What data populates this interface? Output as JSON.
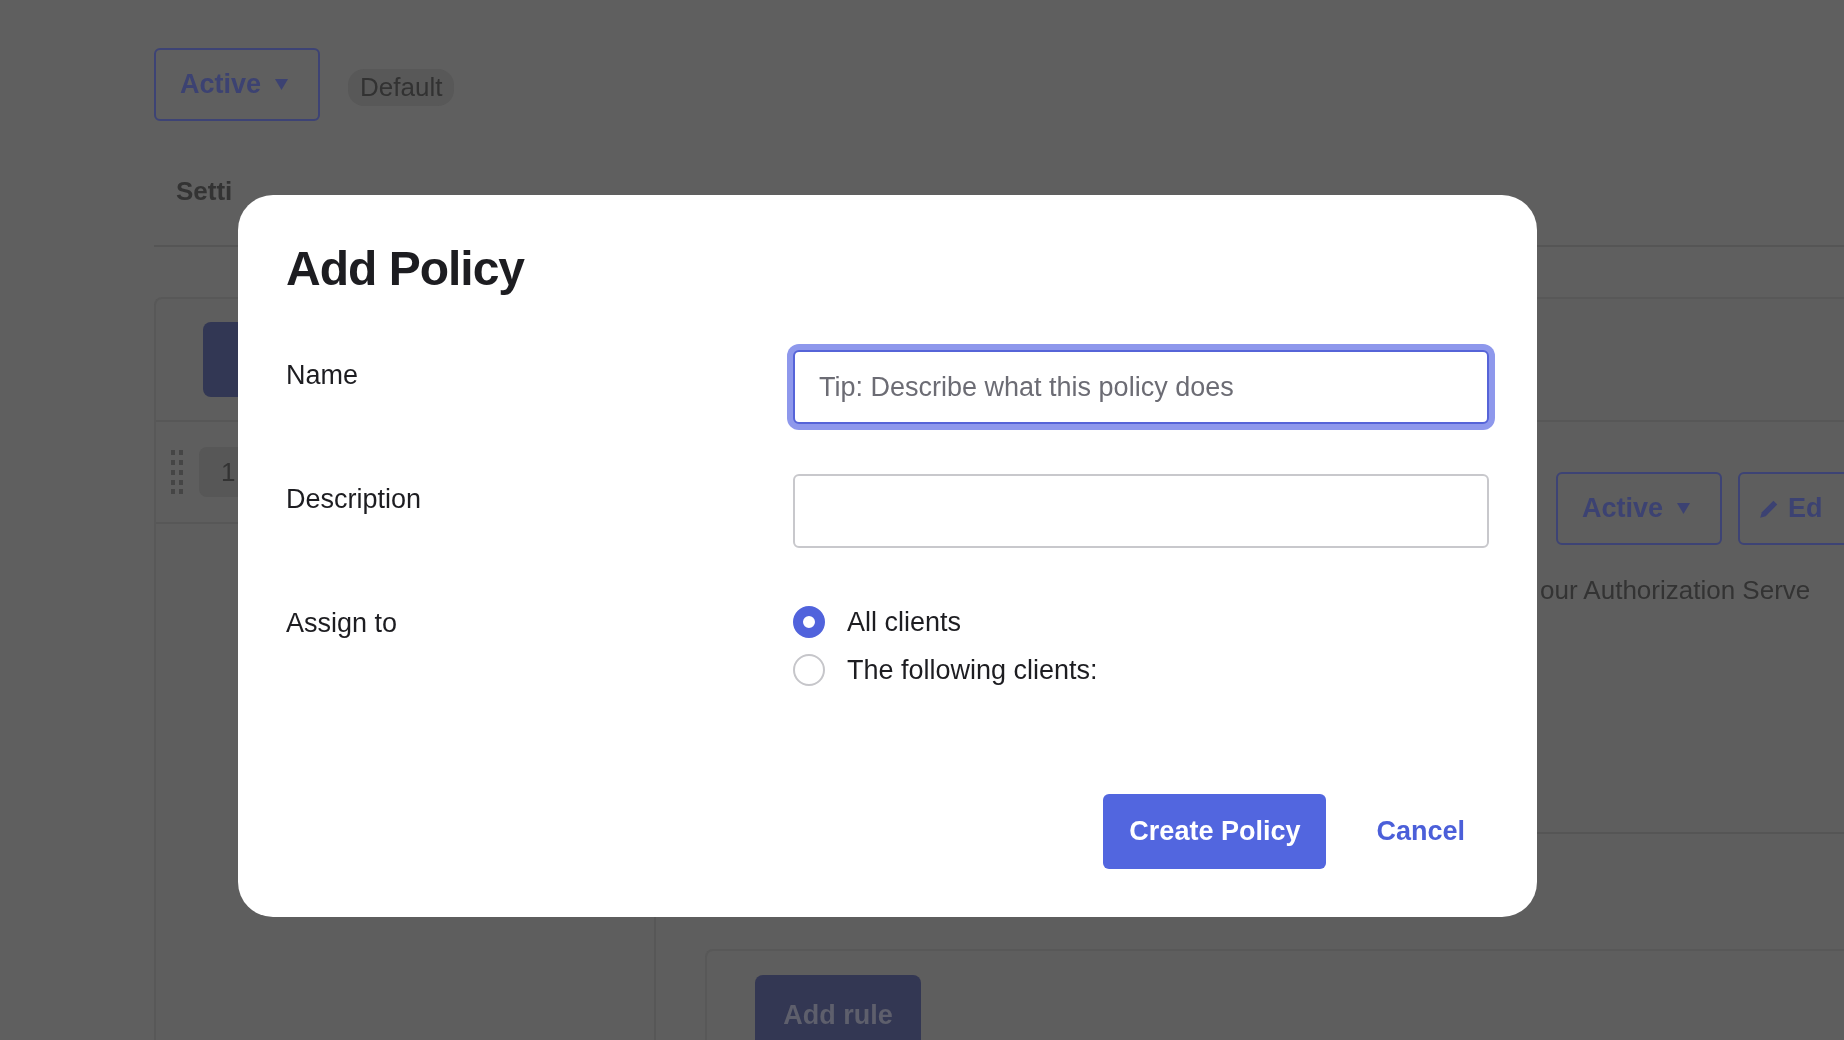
{
  "background": {
    "status_button": {
      "label": "Active"
    },
    "badge": "Default",
    "tab_label": "Setti",
    "priority_badge": "1",
    "rule_status_button": {
      "label": "Active"
    },
    "edit_button": {
      "label": "Ed"
    },
    "description": "our Authorization Serve",
    "add_rule_button": "Add rule"
  },
  "dialog": {
    "title": "Add Policy",
    "fields": [
      {
        "label": "Name",
        "placeholder": "Tip: Describe what this policy does",
        "focused": true
      },
      {
        "label": "Description",
        "focused": false
      }
    ],
    "assign": {
      "label": "Assign to",
      "options": [
        {
          "label": "All clients",
          "selected": true
        },
        {
          "label": "The following clients:",
          "selected": false
        }
      ]
    },
    "buttons": [
      {
        "label": "Create Policy",
        "kind": "primary"
      },
      {
        "label": "Cancel",
        "kind": "link"
      }
    ]
  }
}
